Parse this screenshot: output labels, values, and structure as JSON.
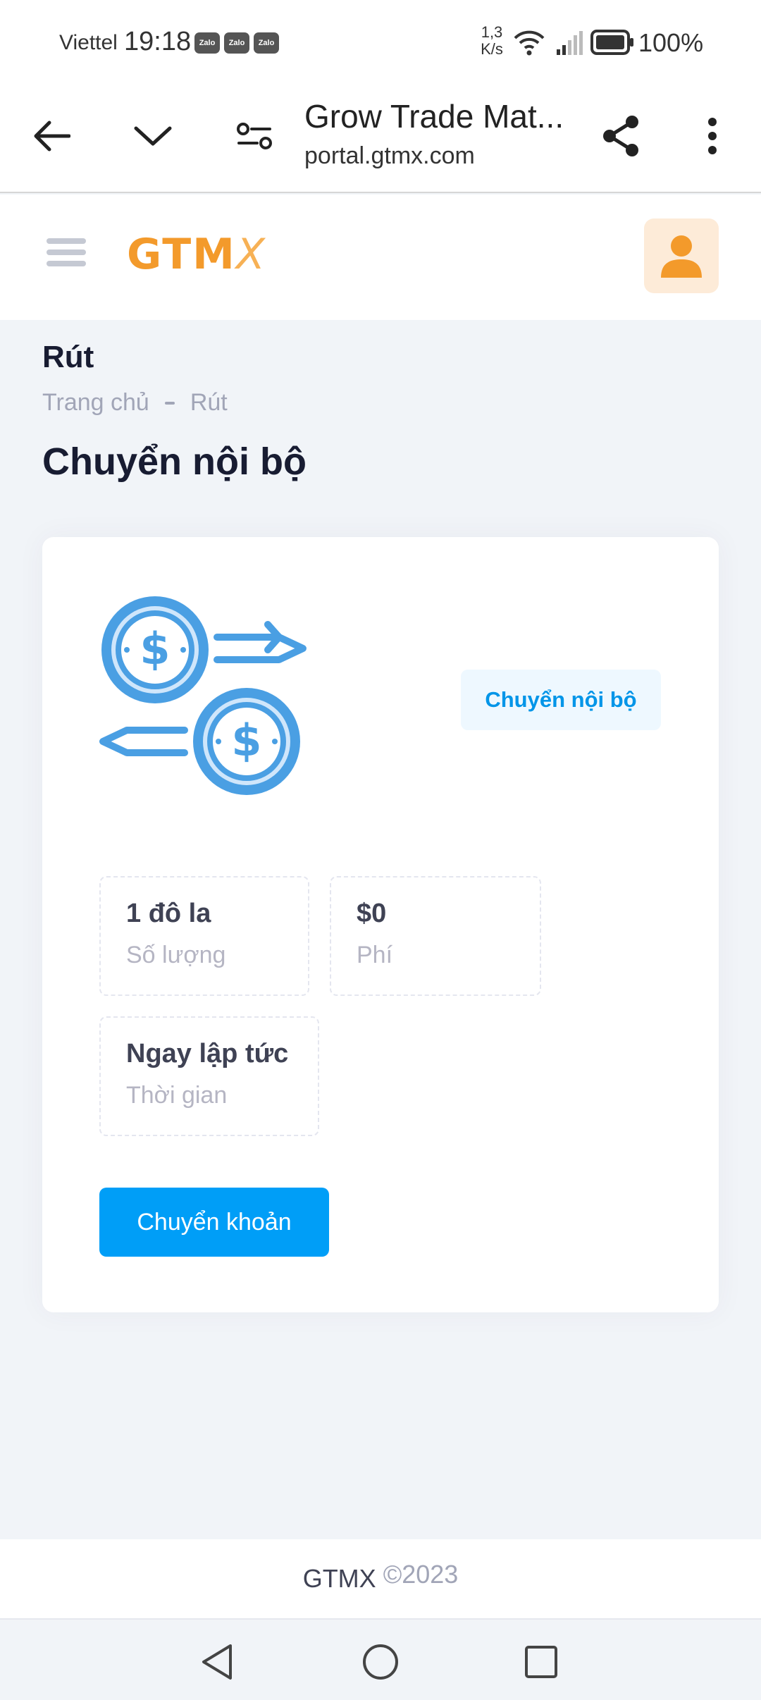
{
  "status_bar": {
    "carrier": "Viettel",
    "time": "19:18",
    "notifications": [
      "Zalo",
      "Zalo",
      "Zalo"
    ],
    "net_speed_value": "1,3",
    "net_speed_unit": "K/s",
    "battery": "100%"
  },
  "browser": {
    "page_title": "Grow Trade Mat...",
    "url": "portal.gtmx.com",
    "icons": [
      "back-arrow-icon",
      "chevron-down-icon",
      "site-settings-icon",
      "share-icon",
      "more-vert-icon"
    ]
  },
  "header": {
    "logo_main": "GTM",
    "logo_x": "X",
    "accent_color": "#f39a2b"
  },
  "page": {
    "title": "Rút",
    "breadcrumb": [
      "Trang chủ",
      "Rút"
    ],
    "section_title": "Chuyển nội bộ"
  },
  "card": {
    "badge": "Chuyển nội bộ",
    "stats": [
      {
        "value": "1 đô la",
        "label": "Số lượng"
      },
      {
        "value": "$0",
        "label": "Phí"
      },
      {
        "value": "Ngay lập tức",
        "label": "Thời gian"
      }
    ],
    "button_label": "Chuyển khoản",
    "button_color": "#009ef7"
  },
  "footer": {
    "brand": "GTMX",
    "year": "©2023"
  }
}
